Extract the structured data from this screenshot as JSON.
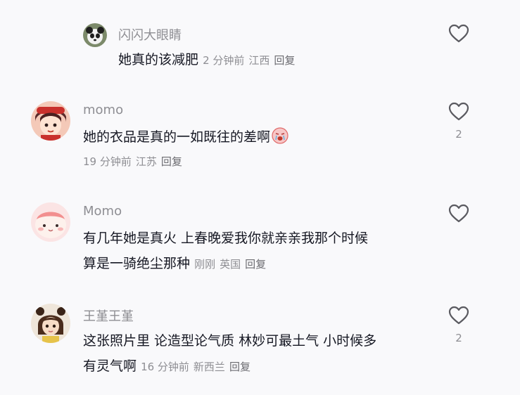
{
  "comments": [
    {
      "username": "闪闪大眼睛",
      "text": "她真的该减肥",
      "time": "2 分钟前",
      "location": "江西",
      "reply": "回复",
      "likes": ""
    },
    {
      "username": "momo",
      "text": "她的衣品是真的一如既往的差啊",
      "time": "19 分钟前",
      "location": "江苏",
      "reply": "回复",
      "likes": "2"
    },
    {
      "username": "Momo",
      "text_line1": "有几年她是真火 上春晚爱我你就亲亲我那个时候",
      "text_line2": "算是一骑绝尘那种",
      "time": "刚刚",
      "location": "英国",
      "reply": "回复",
      "likes": ""
    },
    {
      "username": "王堇王堇",
      "text_line1": "这张照片里 论造型论气质 林妙可最土气 小时候多",
      "text_line2": "有灵气啊",
      "time": "16 分钟前",
      "location": "新西兰",
      "reply": "回复",
      "likes": "2"
    }
  ],
  "colors": {
    "text": "#161823",
    "secondary": "#8e8e93",
    "background": "#f9f9fb"
  },
  "icons": [
    "heart-outline-icon",
    "crying-face-emoji"
  ]
}
